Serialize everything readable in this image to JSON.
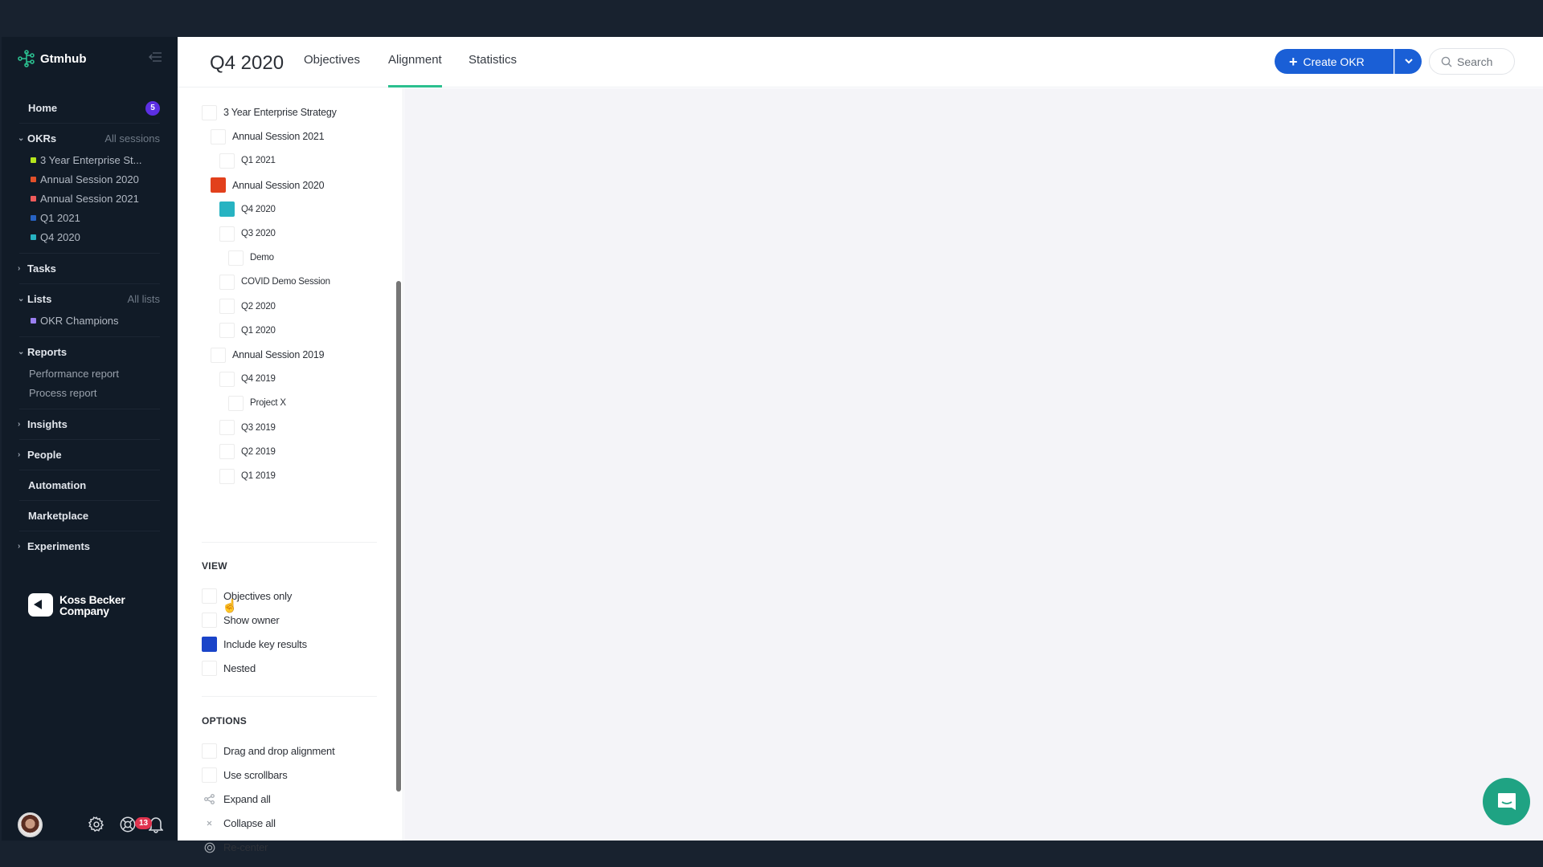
{
  "app": {
    "brand": "Gtmhub",
    "company": [
      "Koss Becker",
      "Company"
    ]
  },
  "sidebar": {
    "home": {
      "label": "Home",
      "badge": "5"
    },
    "okrs": {
      "label": "OKRs",
      "side_link": "All sessions",
      "items": [
        {
          "label": "3 Year Enterprise St...",
          "color": "#b5e51d"
        },
        {
          "label": "Annual Session 2020",
          "color": "#e2502a"
        },
        {
          "label": "Annual Session 2021",
          "color": "#ef5b5b"
        },
        {
          "label": "Q1 2021",
          "color": "#2763c4"
        },
        {
          "label": "Q4 2020",
          "color": "#27b3c2"
        }
      ]
    },
    "tasks": {
      "label": "Tasks"
    },
    "lists": {
      "label": "Lists",
      "side_link": "All lists",
      "items": [
        {
          "label": "OKR Champions",
          "color": "#9a7ff0"
        }
      ]
    },
    "reports": {
      "label": "Reports",
      "items": [
        {
          "label": "Performance report"
        },
        {
          "label": "Process report"
        }
      ]
    },
    "insights": {
      "label": "Insights"
    },
    "people": {
      "label": "People"
    },
    "automation": {
      "label": "Automation"
    },
    "marketplace": {
      "label": "Marketplace"
    },
    "experiments": {
      "label": "Experiments"
    },
    "footer": {
      "notifications_count": "13"
    }
  },
  "header": {
    "title": "Q4 2020",
    "tabs": [
      {
        "label": "Objectives",
        "active": false
      },
      {
        "label": "Alignment",
        "active": true
      },
      {
        "label": "Statistics",
        "active": false
      }
    ],
    "create_button": "Create OKR",
    "search_placeholder": "Search",
    "accent": "#1a5fd6"
  },
  "panel": {
    "sessions": [
      {
        "label": "3 Year Enterprise Strategy",
        "level": 0,
        "checked": false,
        "color": null
      },
      {
        "label": "Annual Session 2021",
        "level": 1,
        "checked": false,
        "color": null
      },
      {
        "label": "Q1 2021",
        "level": 2,
        "checked": false,
        "color": null
      },
      {
        "label": "Annual Session 2020",
        "level": 1,
        "checked": true,
        "color": "#e2401c"
      },
      {
        "label": "Q4 2020",
        "level": 2,
        "checked": true,
        "color": "#27b3c2"
      },
      {
        "label": "Q3 2020",
        "level": 2,
        "checked": false,
        "color": null
      },
      {
        "label": "Demo",
        "level": 3,
        "checked": false,
        "color": null
      },
      {
        "label": "COVID Demo Session",
        "level": 2,
        "checked": false,
        "color": null
      },
      {
        "label": "Q2 2020",
        "level": 2,
        "checked": false,
        "color": null
      },
      {
        "label": "Q1 2020",
        "level": 2,
        "checked": false,
        "color": null
      },
      {
        "label": "Annual Session 2019",
        "level": 1,
        "checked": false,
        "color": null
      },
      {
        "label": "Q4 2019",
        "level": 2,
        "checked": false,
        "color": null
      },
      {
        "label": "Project X",
        "level": 3,
        "checked": false,
        "color": null
      },
      {
        "label": "Q3 2019",
        "level": 2,
        "checked": false,
        "color": null
      },
      {
        "label": "Q2 2019",
        "level": 2,
        "checked": false,
        "color": null
      },
      {
        "label": "Q1 2019",
        "level": 2,
        "checked": false,
        "color": null
      }
    ],
    "view": {
      "heading": "VIEW",
      "items": [
        {
          "label": "Objectives only",
          "checked": false
        },
        {
          "label": "Show owner",
          "checked": false
        },
        {
          "label": "Include key results",
          "checked": true,
          "color": "#1a44c9"
        },
        {
          "label": "Nested",
          "checked": false
        }
      ]
    },
    "options": {
      "heading": "OPTIONS",
      "checkboxes": [
        {
          "label": "Drag and drop alignment",
          "checked": false
        },
        {
          "label": "Use scrollbars",
          "checked": false
        }
      ],
      "actions": [
        {
          "label": "Expand all",
          "icon": "share-icon"
        },
        {
          "label": "Collapse all",
          "icon": "close-icon"
        },
        {
          "label": "Re-center",
          "icon": "target-icon"
        }
      ]
    }
  },
  "chat": {
    "icon": "chat-icon",
    "color": "#1fa383"
  }
}
